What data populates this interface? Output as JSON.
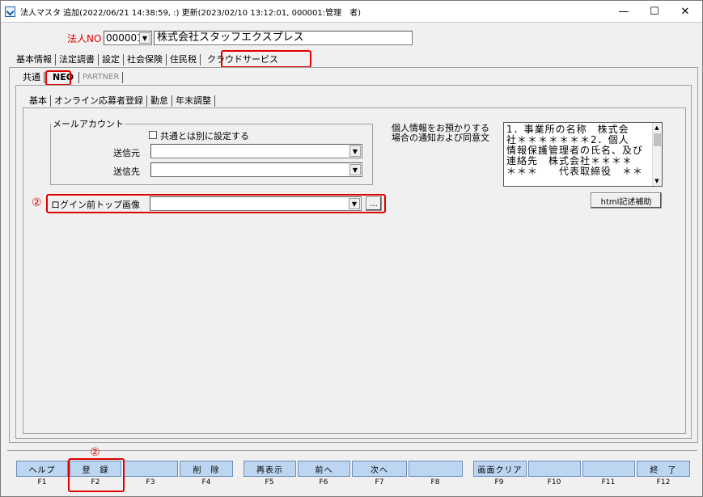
{
  "titlebar": {
    "title": "法人マスタ 追加(2022/06/21 14:38:59, :) 更新(2023/02/10 13:12:01, 000001:管理　者)",
    "minimize": "—",
    "maximize": "☐",
    "close": "✕"
  },
  "header": {
    "label": "法人NO",
    "code": "000001",
    "company": "株式会社スタッフエクスプレス"
  },
  "main_tabs": [
    "基本情報",
    "法定調書",
    "設定",
    "社会保険",
    "住民税",
    "クラウドサービス"
  ],
  "sub_tabs": [
    "共通",
    "NEO",
    "PARTNER"
  ],
  "inner_tabs": [
    "基本",
    "オンライン応募者登録",
    "勤怠",
    "年末調整"
  ],
  "mail": {
    "group_title": "メールアカウント",
    "checkbox_label": "共通とは別に設定する",
    "from_label": "送信元",
    "to_label": "送信先"
  },
  "login": {
    "marker": "②",
    "label": "ログイン前トップ画像",
    "browse": "..."
  },
  "privacy": {
    "label_line1": "個人情報をお預かりする",
    "label_line2": "場合の通知および同意文",
    "text_lines": [
      "1．事業所の名称　株式会",
      "社＊＊＊＊＊＊＊2．個人",
      "情報保護管理者の氏名、及び",
      "連絡先　株式会社＊＊＊＊",
      "＊＊＊　　代表取締役　＊＊"
    ],
    "assist_button": "html記述補助"
  },
  "footer_marker": "②",
  "fkeys": [
    {
      "label": "ヘルプ",
      "key": "F1"
    },
    {
      "label": "登　録",
      "key": "F2"
    },
    {
      "label": "",
      "key": "F3"
    },
    {
      "label": "削　除",
      "key": "F4"
    },
    {
      "label": "再表示",
      "key": "F5"
    },
    {
      "label": "前へ",
      "key": "F6"
    },
    {
      "label": "次へ",
      "key": "F7"
    },
    {
      "label": "",
      "key": "F8"
    },
    {
      "label": "画面クリア",
      "key": "F9"
    },
    {
      "label": "",
      "key": "F10"
    },
    {
      "label": "",
      "key": "F11"
    },
    {
      "label": "終　了",
      "key": "F12"
    }
  ],
  "colors": {
    "highlight": "#e00000",
    "fkey_bg": "#bcd5f1"
  }
}
